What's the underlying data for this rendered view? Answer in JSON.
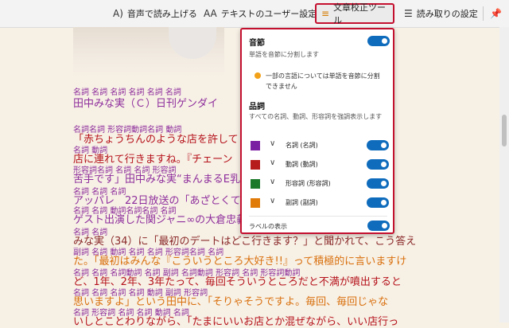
{
  "toolbar": {
    "read_aloud": "音声で読み上げる",
    "read_aloud_icon": "read-aloud-icon",
    "text_prefs": "テキストのユーザー設定",
    "text_prefs_icon": "text-preferences-icon",
    "grammar_tools": "文章校正ツール",
    "grammar_tools_icon": "grammar-tools-icon",
    "reading_prefs": "読み取りの設定",
    "reading_prefs_icon": "reading-preferences-icon",
    "pin_icon": "pin-icon"
  },
  "panel": {
    "syllables_title": "音節",
    "syllables_desc": "単語を音節に分割します",
    "syllables_on": true,
    "warning": "一部の言語については単語を音節に分割できません",
    "pos_title": "品詞",
    "pos_desc": "すべての名詞、動詞、形容詞を強調表示します",
    "items": [
      {
        "label": "名詞 (名詞)",
        "color": "#7b1fa2",
        "on": true
      },
      {
        "label": "動詞 (動詞)",
        "color": "#b71c1c",
        "on": true
      },
      {
        "label": "形容詞 (形容詞)",
        "color": "#1b7a2a",
        "on": true
      },
      {
        "label": "副詞 (副詞)",
        "color": "#e07b0a",
        "on": true
      }
    ],
    "labels_title": "ラベルの表示",
    "labels_on": true
  },
  "article": {
    "l1_tags": "名詞 名詞      名詞 名詞 名詞 名詞",
    "l1_text": "田中みな実（Ｃ）日刊ゲンダイ",
    "l2_tags": "名詞名詞          形容詞動詞名詞 動詞",
    "l2_a": "「赤ちょうちんのような店を許して",
    "l3_tags": "名詞      動詞",
    "l3_a": "店に連れて行きますね。『チェーン",
    "l4_tags": "形容詞名詞   名詞 名詞      形容詞",
    "l4_a": "苦手です」田中みな実“まんまるE乳",
    "l5_tags": "名詞 名詞 名詞",
    "l5_a": "アッパレ　22日放送の「あざとくて",
    "l6_tags": "名詞   名詞 動詞名詞名詞    名詞",
    "l6_a": "ゲスト出演した関ジャニ∞の大倉忠義",
    "l7_tags": "名詞 名詞",
    "l7_a": "みな実（34）に「最初のデートはどこ行きます？」と聞かれて、こう答え",
    "l8_tags": "     副詞      名詞       動詞 名詞 名詞      形容詞名詞 名詞",
    "l8_a": "た。「最初はみんな『こういうところ大好き!!』って積極的に言いますけ",
    "l9_tags": "名詞 名詞 名詞動詞  名詞 副詞 名詞動詞 形容詞 名詞 形容詞動詞",
    "l9_a": "ど、1年、2年、3年たって、毎回そういうところだと不満が噴出すると",
    "l10_tags": "名詞          名詞  名詞      名詞 動詞 副詞  形容詞",
    "l10_a": "思いますよ」という田中に、「そりゃそうですよ。毎回、毎回じゃな",
    "l11_tags": "    名詞                 形容詞 名詞 名詞 動詞     名詞",
    "l11_a": "いしとことわりながら、「たまにいいお店とか混ぜながら、いい店行っ"
  }
}
